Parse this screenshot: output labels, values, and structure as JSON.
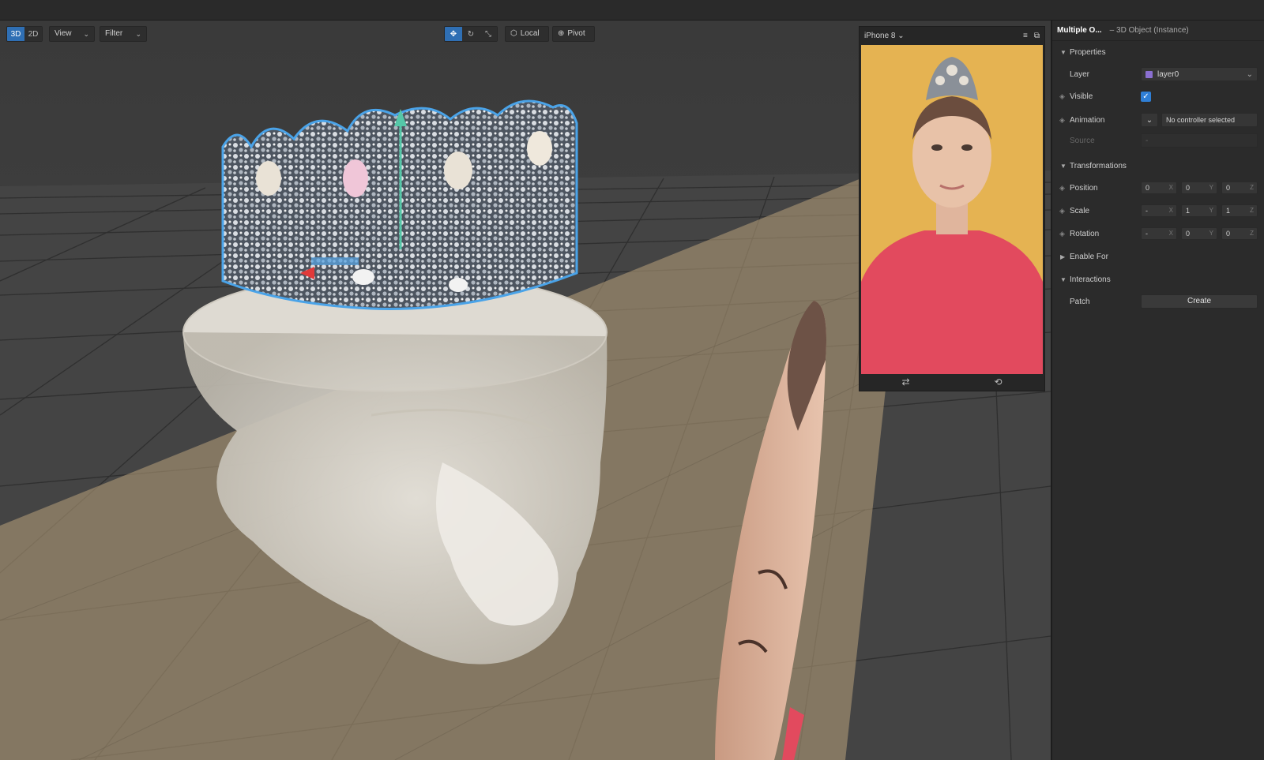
{
  "toolbar": {
    "mode_3d": "3D",
    "mode_2d": "2D",
    "view_label": "View",
    "filter_label": "Filter",
    "local_label": "Local",
    "pivot_label": "Pivot"
  },
  "simulator": {
    "device": "iPhone 8"
  },
  "inspector": {
    "title": "Multiple O...",
    "subtitle": "– 3D Object (Instance)",
    "sections": {
      "properties": "Properties",
      "transformations": "Transformations",
      "enable_for": "Enable For",
      "interactions": "Interactions"
    },
    "layer_label": "Layer",
    "layer_value": "layer0",
    "layer_color": "#8a6fd0",
    "visible_label": "Visible",
    "animation_label": "Animation",
    "animation_value": "No controller selected",
    "source_label": "Source",
    "source_value": "-",
    "position_label": "Position",
    "position": {
      "x": "0",
      "y": "0",
      "z": "0"
    },
    "scale_label": "Scale",
    "scale": {
      "x": "-",
      "y": "1",
      "z": "1"
    },
    "rotation_label": "Rotation",
    "rotation": {
      "x": "-",
      "y": "0",
      "z": "0"
    },
    "patch_label": "Patch",
    "create_label": "Create",
    "axis_x": "X",
    "axis_y": "Y",
    "axis_z": "Z"
  },
  "colors": {
    "accent": "#2f6fb4",
    "viewport_bg": "#3e3e3e",
    "sim_background": "#e5b352",
    "sweater": "#e24a5e"
  }
}
